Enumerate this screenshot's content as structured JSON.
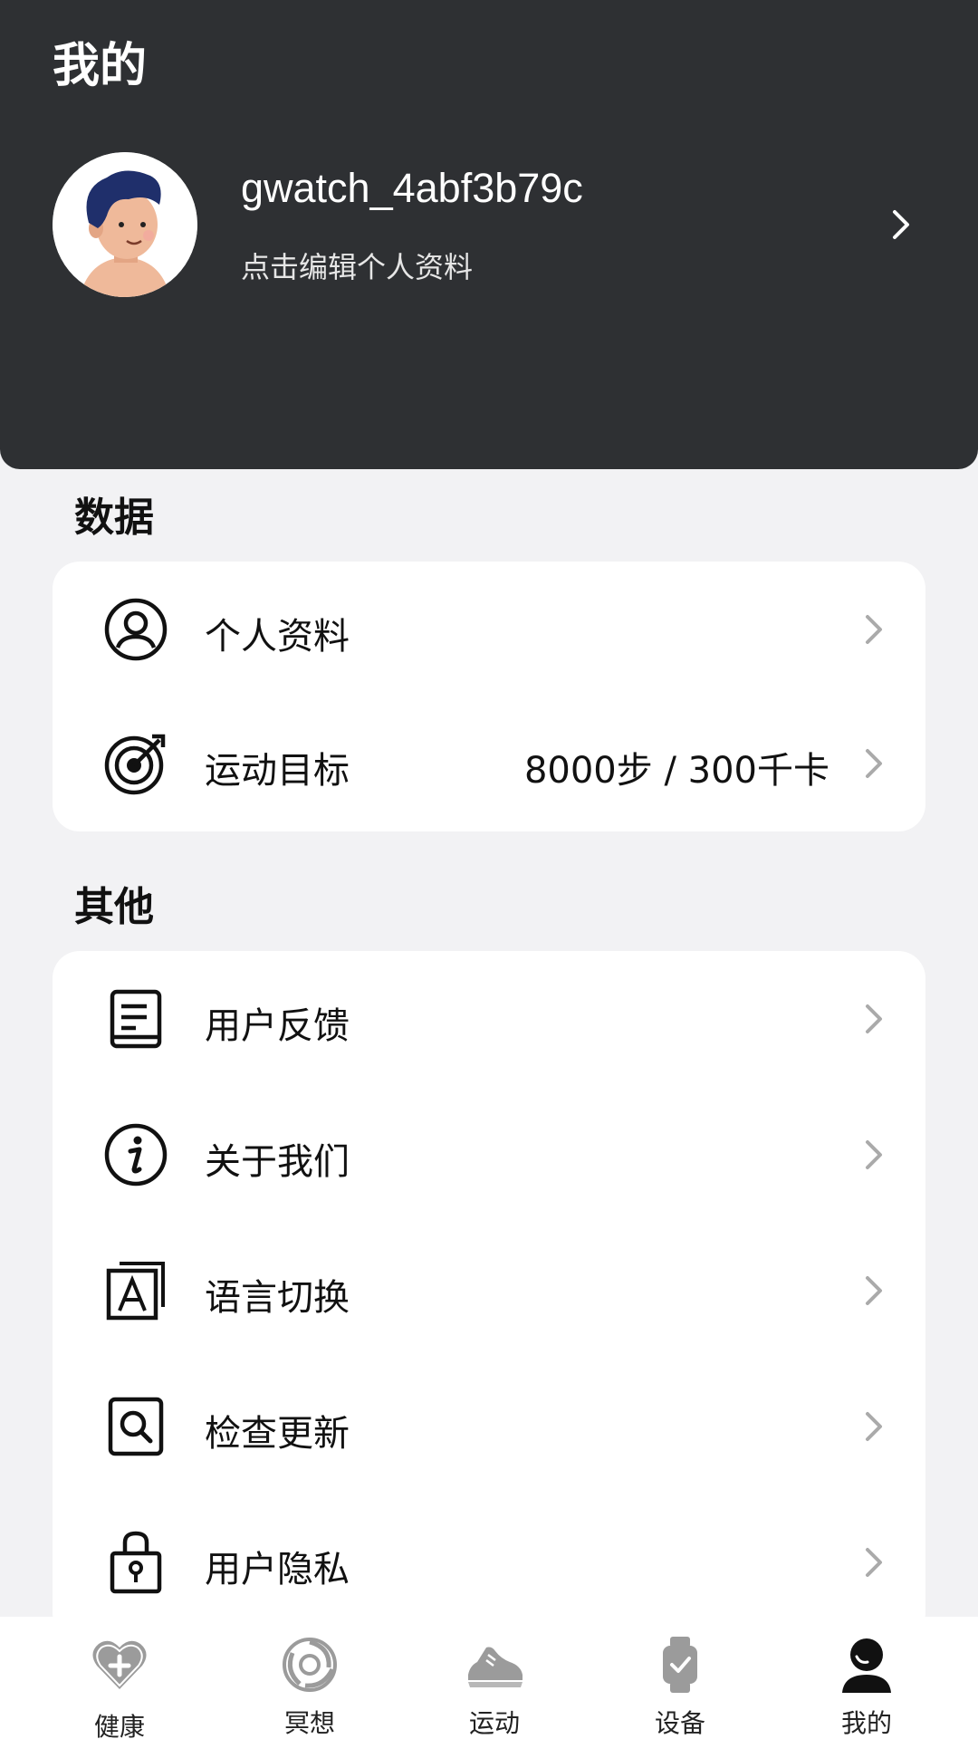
{
  "header": {
    "title": "我的",
    "username": "gwatch_4abf3b79c",
    "subtitle": "点击编辑个人资料"
  },
  "sections": {
    "data": {
      "title": "数据",
      "items": [
        {
          "label": "个人资料",
          "icon": "user-circle-icon"
        },
        {
          "label": "运动目标",
          "value": "8000步 / 300千卡",
          "icon": "target-icon"
        }
      ]
    },
    "other": {
      "title": "其他",
      "items": [
        {
          "label": "用户反馈",
          "icon": "feedback-icon"
        },
        {
          "label": "关于我们",
          "icon": "info-icon"
        },
        {
          "label": "语言切换",
          "icon": "language-icon"
        },
        {
          "label": "检查更新",
          "icon": "search-update-icon"
        },
        {
          "label": "用户隐私",
          "icon": "lock-icon"
        }
      ]
    }
  },
  "tabbar": {
    "items": [
      {
        "label": "健康",
        "icon": "health-heart-icon"
      },
      {
        "label": "冥想",
        "icon": "meditation-swirl-icon"
      },
      {
        "label": "运动",
        "icon": "running-shoe-icon"
      },
      {
        "label": "设备",
        "icon": "watch-icon"
      },
      {
        "label": "我的",
        "icon": "profile-icon",
        "active": true
      }
    ]
  },
  "colors": {
    "header_bg": "#2e3033",
    "page_bg": "#f2f2f4",
    "card_bg": "#ffffff",
    "inactive_icon": "#9b9b9b",
    "active_icon": "#111111"
  }
}
